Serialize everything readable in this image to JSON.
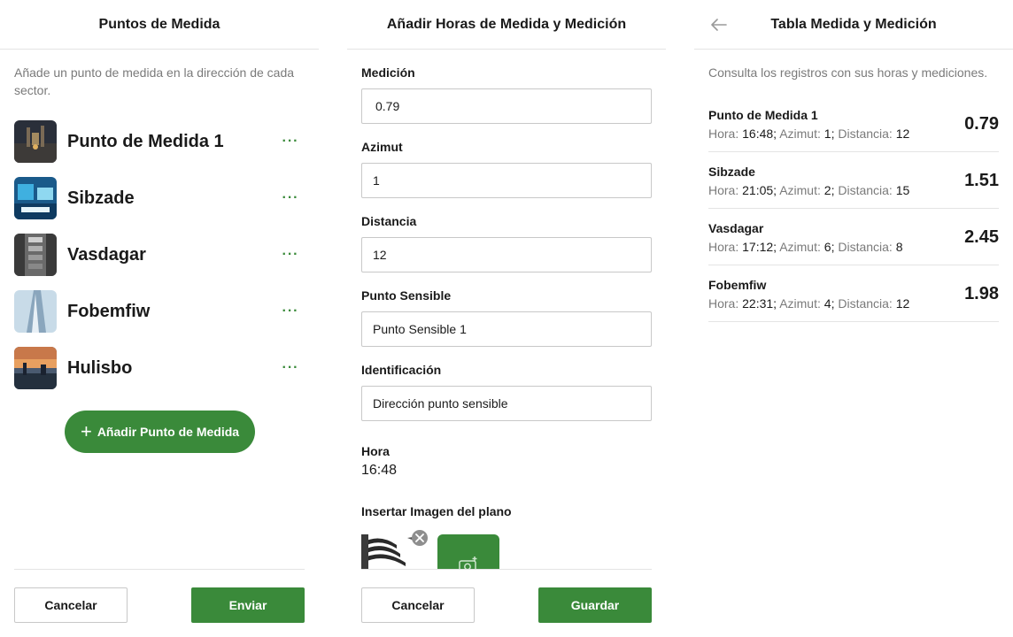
{
  "panel1": {
    "title": "Puntos de Medida",
    "description": "Añade un punto de medida en la dirección de cada sector.",
    "items": [
      {
        "label": "Punto de Medida 1"
      },
      {
        "label": "Sibzade"
      },
      {
        "label": "Vasdagar"
      },
      {
        "label": "Fobemfiw"
      },
      {
        "label": "Hulisbo"
      }
    ],
    "add_label": "Añadir Punto de Medida",
    "cancel_label": "Cancelar",
    "submit_label": "Enviar"
  },
  "panel2": {
    "title": "Añadir Horas de Medida y Medición",
    "medicion_label": "Medición",
    "medicion_value": "0.79",
    "azimut_label": "Azimut",
    "azimut_value": "1",
    "distancia_label": "Distancia",
    "distancia_value": "12",
    "punto_sensible_label": "Punto Sensible",
    "punto_sensible_value": "Punto Sensible 1",
    "identificacion_label": "Identificación",
    "identificacion_value": "Dirección punto sensible",
    "hora_label": "Hora",
    "hora_value": "16:48",
    "imagen_label": "Insertar Imagen del plano",
    "cancel_label": "Cancelar",
    "save_label": "Guardar"
  },
  "panel3": {
    "title": "Tabla Medida y Medición",
    "description": "Consulta los registros con sus horas y mediciones.",
    "hora_key": "Hora:",
    "azimut_key": "Azimut:",
    "distancia_key": "Distancia:",
    "records": [
      {
        "name": "Punto de Medida 1",
        "hora": "16:48",
        "azimut": "1",
        "distancia": "12",
        "value": "0.79"
      },
      {
        "name": "Sibzade",
        "hora": "21:05",
        "azimut": "2",
        "distancia": "15",
        "value": "1.51"
      },
      {
        "name": "Vasdagar",
        "hora": "17:12",
        "azimut": "6",
        "distancia": "8",
        "value": "2.45"
      },
      {
        "name": "Fobemfiw",
        "hora": "22:31",
        "azimut": "4",
        "distancia": "12",
        "value": "1.98"
      }
    ]
  },
  "colors": {
    "accent": "#3a8a3a",
    "border": "#c8c8c8",
    "muted_text": "#7a7a7a"
  },
  "icons": [
    "more-icon",
    "plus-icon",
    "back-arrow-icon",
    "remove-icon",
    "add-photo-icon"
  ]
}
